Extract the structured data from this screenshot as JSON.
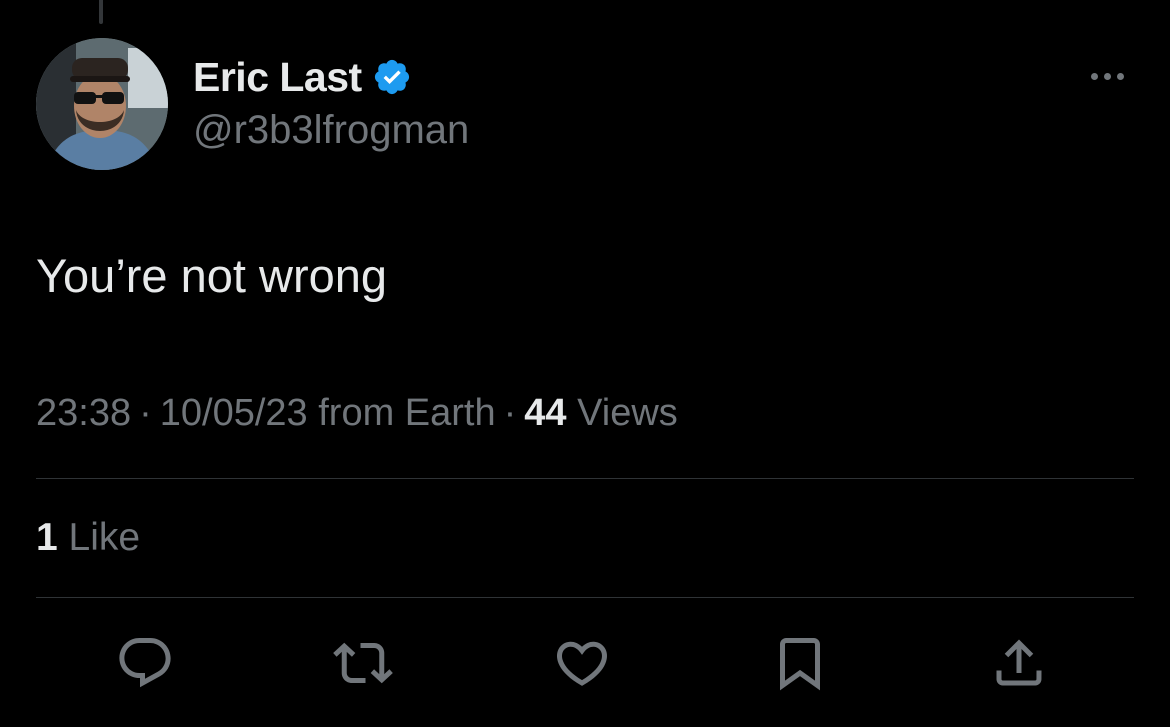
{
  "author": {
    "display_name": "Eric Last",
    "handle": "@r3b3lfrogman",
    "verified": true,
    "avatar_icon": "profile-photo"
  },
  "tweet": {
    "text": "You’re not wrong"
  },
  "meta": {
    "time": "23:38",
    "separator": "·",
    "date": "10/05/23",
    "source": "from Earth",
    "views_count": "44",
    "views_label": "Views"
  },
  "engagement": {
    "likes_count": "1",
    "likes_label": "Like"
  },
  "actions": [
    {
      "name": "reply",
      "icon": "speech-bubble-icon"
    },
    {
      "name": "repost",
      "icon": "repost-arrows-icon"
    },
    {
      "name": "like",
      "icon": "heart-icon"
    },
    {
      "name": "bookmark",
      "icon": "bookmark-icon"
    },
    {
      "name": "share",
      "icon": "share-upload-icon"
    }
  ],
  "colors": {
    "background": "#000000",
    "primary_text": "#e7e9ea",
    "secondary_text": "#71767b",
    "divider": "#2f3336",
    "verified_badge": "#1d9bf0"
  }
}
